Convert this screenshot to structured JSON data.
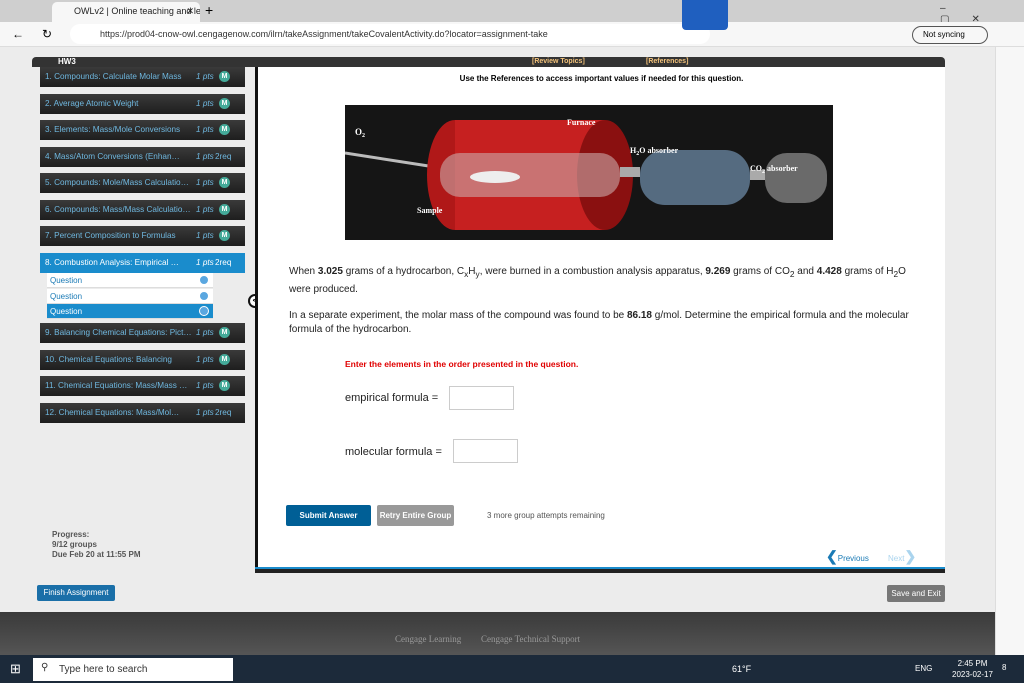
{
  "browser": {
    "tab_title": "OWLv2 | Online teaching and lea",
    "url": "https://prod04-cnow-owl.cengagenow.com/ilrn/takeAssignment/takeCovalentActivity.do?locator=assignment-take",
    "sync_label": "Not syncing"
  },
  "sidebar": {
    "title": "HW3",
    "items": [
      {
        "label": "1. Compounds: Calculate Molar Mass",
        "pts": "1 pts",
        "status": "M"
      },
      {
        "label": "2. Average Atomic Weight",
        "pts": "1 pts",
        "status": "M"
      },
      {
        "label": "3. Elements: Mass/Mole Conversions",
        "pts": "1 pts",
        "status": "M"
      },
      {
        "label": "4. Mass/Atom Conversions (Enhan…",
        "pts": "1 pts",
        "status": "2req"
      },
      {
        "label": "5. Compounds: Mole/Mass Calculatio…",
        "pts": "1 pts",
        "status": "M"
      },
      {
        "label": "6. Compounds: Mass/Mass Calculatio…",
        "pts": "1 pts",
        "status": "M"
      },
      {
        "label": "7. Percent Composition to Formulas",
        "pts": "1 pts",
        "status": "M"
      },
      {
        "label": "8. Combustion Analysis: Empirical …",
        "pts": "1 pts",
        "status": "2req"
      },
      {
        "label": "9. Balancing Chemical Equations: Pict…",
        "pts": "1 pts",
        "status": "M"
      },
      {
        "label": "10. Chemical Equations: Balancing",
        "pts": "1 pts",
        "status": "M"
      },
      {
        "label": "11. Chemical Equations: Mass/Mass …",
        "pts": "1 pts",
        "status": "M"
      },
      {
        "label": "12. Chemical Equations: Mass/Mol…",
        "pts": "1 pts",
        "status": "2req"
      }
    ],
    "subitems": [
      "Question",
      "Question",
      "Question"
    ],
    "progress_label": "Progress:",
    "progress_value": "9/12 groups",
    "due": "Due Feb 20 at 11:55 PM",
    "finish_label": "Finish Assignment"
  },
  "main": {
    "review_topics": "[Review Topics]",
    "references": "[References]",
    "instructions": "Use the References to access important values if needed for this question.",
    "diagram": {
      "o2": "O",
      "o2_sub": "2",
      "furnace": "Furnace",
      "h2o": "H",
      "h2o_sub": "2",
      "h2o_rest": "O absorber",
      "co2": "CO",
      "co2_sub": "2",
      "co2_rest": " absorber",
      "sample": "Sample"
    },
    "q1": {
      "a": "When ",
      "m1": "3.025",
      "b": " grams of a hydrocarbon, C",
      "x": "x",
      "c": "H",
      "y": "y",
      "d": ", were burned in a combustion analysis apparatus, ",
      "m2": "9.269",
      "e": " grams of CO",
      "two": "2",
      "f": " and ",
      "m3": "4.428",
      "g": " grams of H",
      "two2": "2",
      "h": "O were produced."
    },
    "q2": {
      "a": "In a separate experiment, the molar mass of the compound was found to be ",
      "m": "86.18",
      "b": " g/mol. Determine the empirical formula and the molecular formula of the hydrocarbon."
    },
    "order_note": "Enter the elements in the order presented in the question.",
    "empirical_label": "empirical formula =",
    "empirical_value": "",
    "molecular_label": "molecular formula =",
    "molecular_value": "",
    "submit": "Submit Answer",
    "retry": "Retry Entire Group",
    "attempts": "3 more group attempts remaining",
    "previous": "Previous",
    "next": "Next",
    "save_exit": "Save and Exit"
  },
  "footer": {
    "links": [
      "Cengage Learning",
      "Cengage Technical Support"
    ]
  },
  "taskbar": {
    "search_placeholder": "Type here to search",
    "weather": "61°F",
    "lang": "ENG",
    "time": "2:45 PM",
    "date": "2023-02-17",
    "notifications": "8"
  },
  "colors": {
    "accent": "#1a8ccc",
    "submit": "#005f96",
    "warning_red": "#e00000"
  }
}
